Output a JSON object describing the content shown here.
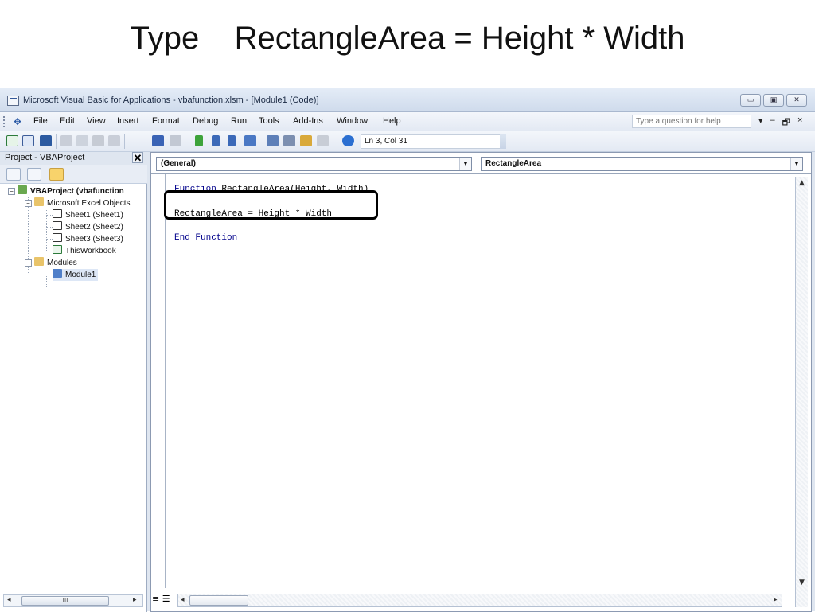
{
  "slide": {
    "title": "Type    RectangleArea = Height * Width"
  },
  "window": {
    "title": "Microsoft Visual Basic for Applications - vbafunction.xlsm - [Module1 (Code)]",
    "min_glyph": "▭",
    "max_glyph": "▣",
    "close_glyph": "✕"
  },
  "menu": {
    "items": [
      "File",
      "Edit",
      "View",
      "Insert",
      "Format",
      "Debug",
      "Run",
      "Tools",
      "Add-Ins",
      "Window",
      "Help"
    ],
    "help_placeholder": "Type a question for help",
    "mdi_glyphs": [
      "▾",
      "–",
      "🗗",
      "×"
    ]
  },
  "toolbar": {
    "status": "Ln 3, Col 31"
  },
  "project": {
    "header": "Project - VBAProject",
    "close": "✕",
    "tree": {
      "root": "VBAProject (vbafunction",
      "excel_objects": "Microsoft Excel Objects",
      "sheet1": "Sheet1 (Sheet1)",
      "sheet2": "Sheet2 (Sheet2)",
      "sheet3": "Sheet3 (Sheet3)",
      "workbook": "ThisWorkbook",
      "modules": "Modules",
      "module1": "Module1"
    },
    "scroll_grip": "III"
  },
  "code": {
    "object_combo": "(General)",
    "proc_combo": "RectangleArea",
    "line1_kw": "Function",
    "line1_rest": " RectangleArea(Height, Width)",
    "line2": "RectangleArea = Height * Width",
    "line3": "End Function"
  },
  "colors": {
    "keyword": "#00008b",
    "highlight_border": "#000000",
    "chrome": "#dfe6f0"
  }
}
